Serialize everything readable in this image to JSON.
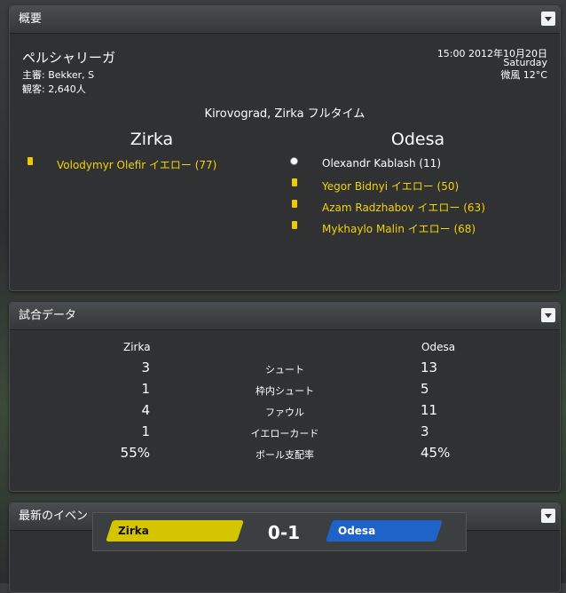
{
  "overview": {
    "header": "概要",
    "competition": "ペルシャリーガ",
    "referee": "主審: Bekker, S",
    "attendance": "観客: 2,640人",
    "datetime": "15:00  2012年10月20日",
    "weekday": "Saturday",
    "weather": "微風 12°C",
    "venue_status": "Kirovograd, Zirka フルタイム",
    "home_team": "Zirka",
    "away_team": "Odesa",
    "home_events": [
      {
        "text": "Volodymyr Olefir イエロー (77)",
        "icon": "yellow-card-icon",
        "color": "#f5d20a"
      }
    ],
    "away_events": [
      {
        "text": "Olexandr Kablash (11)",
        "icon": "football-icon",
        "color": "#ffffff"
      },
      {
        "text": "Yegor Bidnyi イエロー (50)",
        "icon": "yellow-card-icon",
        "color": "#f5d20a"
      },
      {
        "text": "Azam Radzhabov イエロー (63)",
        "icon": "yellow-card-icon",
        "color": "#f5d20a"
      },
      {
        "text": "Mykhaylo Malin イエロー (68)",
        "icon": "yellow-card-icon",
        "color": "#f5d20a"
      }
    ]
  },
  "match_stats": {
    "header": "試合データ",
    "home_label": "Zirka",
    "away_label": "Odesa",
    "rows": [
      {
        "label": "シュート",
        "home": "3",
        "away": "13"
      },
      {
        "label": "枠内シュート",
        "home": "1",
        "away": "5"
      },
      {
        "label": "ファウル",
        "home": "4",
        "away": "11"
      },
      {
        "label": "イエローカード",
        "home": "1",
        "away": "3"
      },
      {
        "label": "ボール支配率",
        "home": "55%",
        "away": "45%"
      }
    ]
  },
  "latest_events": {
    "header": "最新のイベン"
  },
  "scoreboard": {
    "home": "Zirka",
    "away": "Odesa",
    "score": "0-1",
    "home_color": "#d4c500",
    "away_color": "#1f63c9"
  }
}
